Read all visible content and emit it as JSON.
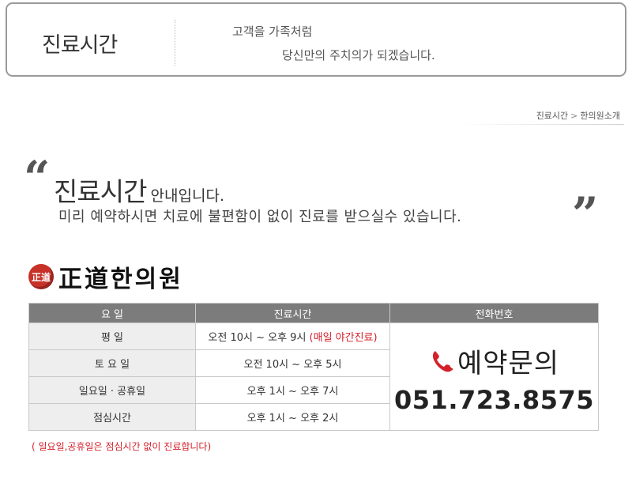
{
  "header": {
    "title": "진료시간",
    "slogan_line1": "고객을 가족처럼",
    "slogan_line2": "당신만의 주치의가 되겠습니다."
  },
  "breadcrumb": {
    "items": [
      "진료시간",
      "한의원소개"
    ],
    "separator": ">"
  },
  "intro": {
    "title": "진료시간",
    "title_suffix": "안내입니다.",
    "subtitle": "미리 예약하시면 치료에 불편함이 없이 진료를 받으실수 있습니다.",
    "quote_open": "66",
    "quote_close": "99"
  },
  "logo": {
    "seal_text": "正道",
    "name": "正道한의원"
  },
  "table": {
    "headers": [
      "요  일",
      "진료시간",
      "전화번호"
    ],
    "rows": [
      {
        "day": "평     일",
        "hours": "오전 10시  ~  오후 9시 ",
        "extra": "(매일 야간진료)",
        "highlight": false
      },
      {
        "day": "토 요 일",
        "hours": "오전 10시  ~  오후 5시",
        "extra": "",
        "highlight": false
      },
      {
        "day": "일요일 · 공휴일",
        "hours": "오후 1시  ~  오후 7시",
        "extra": "",
        "highlight": true
      },
      {
        "day": "점심시간",
        "hours": "오후 1시 ~ 오후 2시",
        "extra": "",
        "highlight": false
      }
    ],
    "phone_label": "예약문의",
    "phone_number": "051.723.8575",
    "phone_icon": "phone-icon"
  },
  "note": "( 일요일,공휴일은 점심시간 없이 진료합니다)",
  "colors": {
    "accent_red": "#d3202a",
    "header_gray": "#7c7c7c",
    "row_gray": "#eeeeee"
  }
}
